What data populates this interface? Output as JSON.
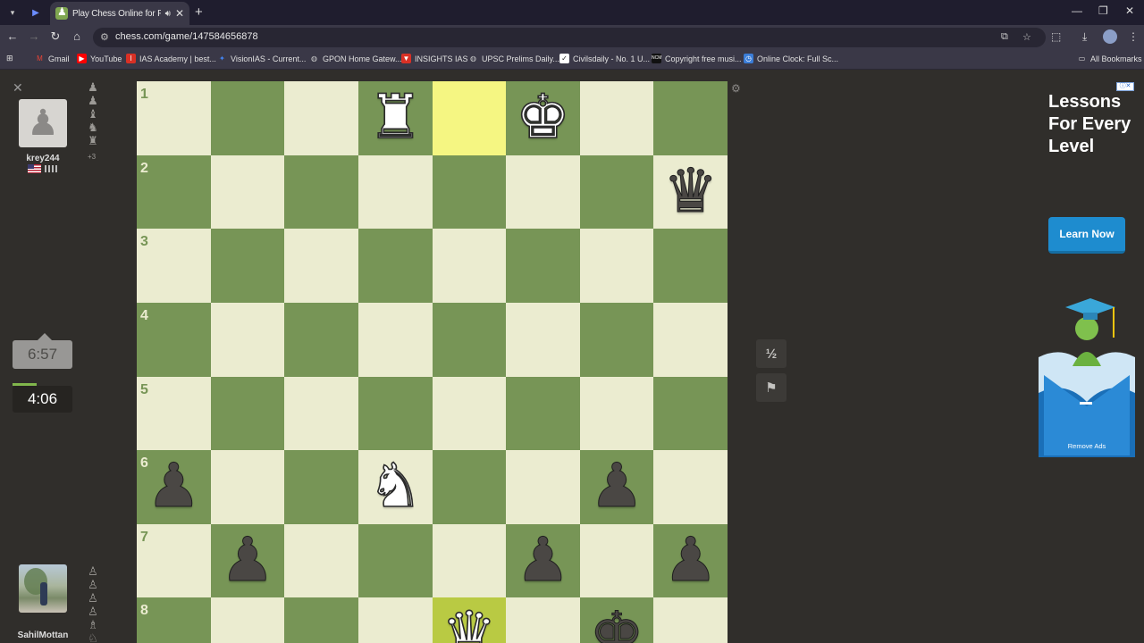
{
  "browser": {
    "tab_title": "Play Chess Online for FREE",
    "url": "chess.com/game/147584656878",
    "bookmarks": [
      {
        "label": "Gmail",
        "icon": "gmail-icon",
        "color": "#ea4335"
      },
      {
        "label": "YouTube",
        "icon": "youtube-icon",
        "color": "#ff0000"
      },
      {
        "label": "IAS Academy | best...",
        "icon": "ias-icon",
        "color": "#d93025"
      },
      {
        "label": "VisionIAS - Current...",
        "icon": "vision-icon",
        "color": "#4285f4"
      },
      {
        "label": "GPON Home Gatew...",
        "icon": "globe-icon",
        "color": "#cccccc"
      },
      {
        "label": "INSIGHTS IAS",
        "icon": "insights-icon",
        "color": "#d93025"
      },
      {
        "label": "UPSC Prelims Daily...",
        "icon": "globe-icon",
        "color": "#cccccc"
      },
      {
        "label": "Civilsdaily - No. 1 U...",
        "icon": "civils-icon",
        "color": "#222222"
      },
      {
        "label": "Copyright free musi...",
        "icon": "ncm-icon",
        "color": "#111111"
      },
      {
        "label": "Online Clock: Full Sc...",
        "icon": "clock-icon",
        "color": "#3b7dd8"
      }
    ],
    "all_bookmarks": "All Bookmarks"
  },
  "opponent": {
    "name": "krey244",
    "captured": [
      "♟",
      "♟",
      "♝",
      "♞",
      "♜"
    ],
    "captured_extra": "+3",
    "clock": "6:57"
  },
  "player": {
    "name": "SahilMottan",
    "captured": [
      "♙",
      "♙",
      "♙",
      "♙",
      "♗",
      "♘"
    ],
    "clock": "4:06"
  },
  "board": {
    "colors": {
      "light": "#ebecd0",
      "dark": "#779556",
      "highlight_light": "#f5f682",
      "highlight_dark": "#b9ca43"
    },
    "rank_labels": [
      "1",
      "2",
      "3",
      "4",
      "5",
      "6",
      "7",
      "8"
    ],
    "rows": [
      [
        "",
        "",
        "",
        "wR",
        "",
        "wK",
        "",
        ""
      ],
      [
        "",
        "",
        "",
        "",
        "",
        "",
        "",
        "bQ"
      ],
      [
        "",
        "",
        "",
        "",
        "",
        "",
        "",
        ""
      ],
      [
        "",
        "",
        "",
        "",
        "",
        "",
        "",
        ""
      ],
      [
        "",
        "",
        "",
        "",
        "",
        "",
        "",
        ""
      ],
      [
        "bP",
        "",
        "",
        "wN",
        "",
        "",
        "bP",
        ""
      ],
      [
        "",
        "bP",
        "",
        "",
        "",
        "bP",
        "",
        "bP"
      ],
      [
        "",
        "",
        "",
        "",
        "wQ",
        "",
        "bK",
        ""
      ]
    ],
    "highlights": [
      [
        0,
        4
      ],
      [
        7,
        4
      ]
    ]
  },
  "controls": {
    "draw_label": "½",
    "resign_icon": "flag-icon",
    "settings_icon": "gear-icon"
  },
  "ad": {
    "tag": "ⓘ✕",
    "headline": "Lessons For Every Level",
    "cta": "Learn Now",
    "remove": "Remove Ads"
  }
}
